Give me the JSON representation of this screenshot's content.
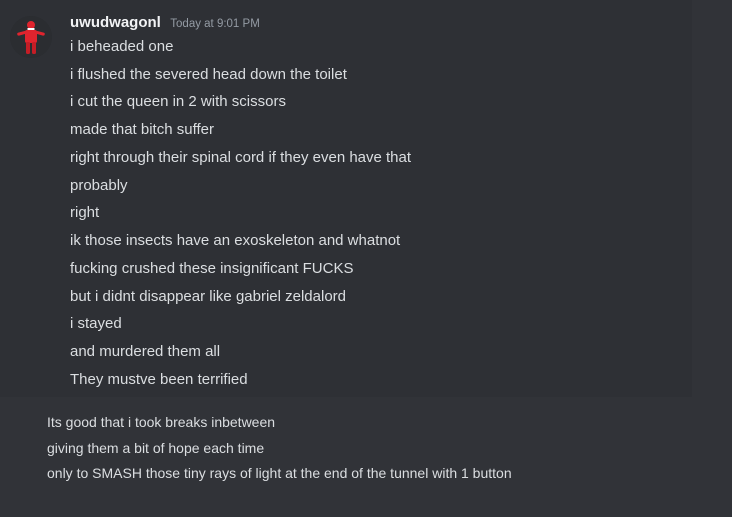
{
  "message": {
    "author": "uwudwagonl",
    "timestamp": "Today at 9:01 PM",
    "lines": [
      "i beheaded one",
      "i flushed the severed head down the toilet",
      "i cut the queen in 2 with scissors",
      "made that bitch suffer",
      "right through their spinal cord if they even have that",
      "probably",
      "right",
      "ik those insects have an exoskeleton and whatnot",
      "fucking crushed these insignificant FUCKS",
      "but i didnt disappear like gabriel zeldalord",
      "i stayed",
      "and murdered them all",
      "They mustve been terrified"
    ]
  },
  "followup": {
    "lines": [
      "Its good that i took breaks inbetween",
      "giving them a bit of hope each time",
      "only to SMASH those tiny rays of light at the end of the tunnel with 1 button"
    ]
  },
  "colors": {
    "background": "#313338",
    "hover_background": "#2e3035",
    "text": "#dbdee1",
    "username": "#f2f3f5",
    "timestamp": "#949ba4",
    "avatar_figure": "#e0242e"
  }
}
